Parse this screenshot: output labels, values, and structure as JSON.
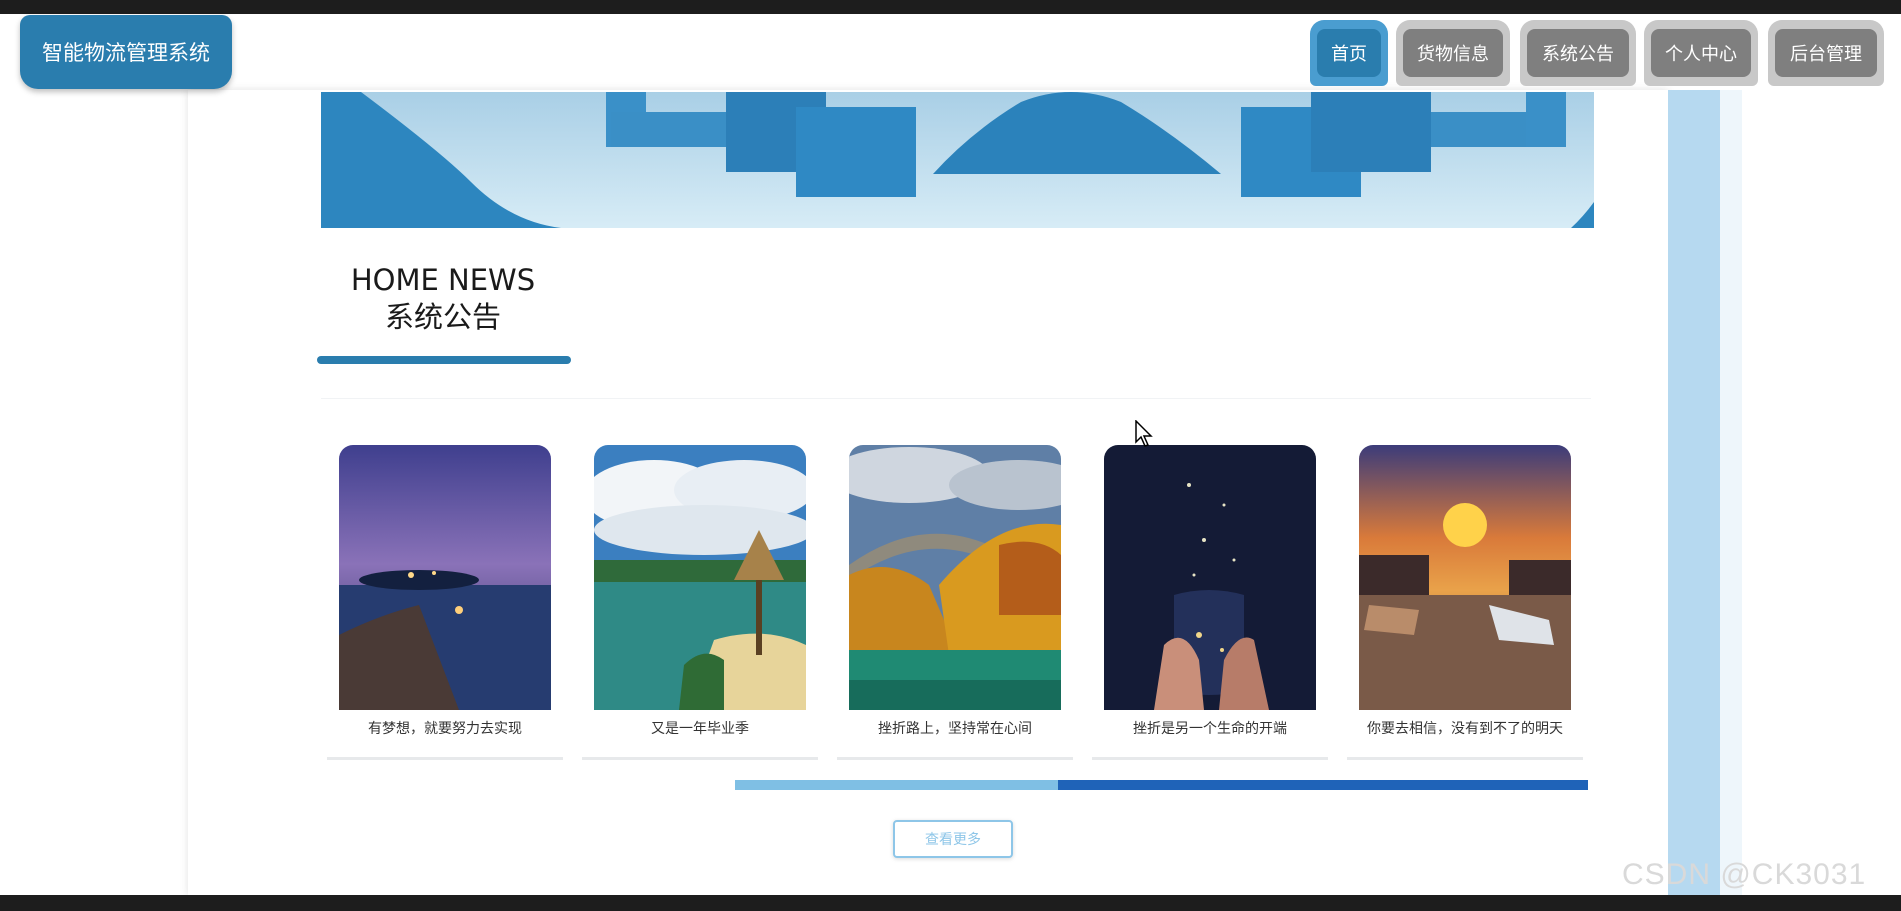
{
  "app": {
    "title": "智能物流管理系统"
  },
  "nav": {
    "items": [
      {
        "label": "首页",
        "active": true
      },
      {
        "label": "货物信息",
        "active": false
      },
      {
        "label": "系统公告",
        "active": false
      },
      {
        "label": "个人中心",
        "active": false
      },
      {
        "label": "后台管理",
        "active": false
      }
    ]
  },
  "section": {
    "title_en": "HOME NEWS",
    "title_zh": "系统公告"
  },
  "news": [
    {
      "caption": "有梦想，就要努力去实现",
      "image": "night-pier-sunset"
    },
    {
      "caption": "又是一年毕业季",
      "image": "tropical-beach-hut"
    },
    {
      "caption": "挫折路上，坚持常在心间",
      "image": "autumn-stone-bridge"
    },
    {
      "caption": "挫折是另一个生命的开端",
      "image": "starry-jar-hands"
    },
    {
      "caption": "你要去相信，没有到不了的明天",
      "image": "sunset-river-city"
    }
  ],
  "carousel": {
    "progress": 0.62
  },
  "more_button": {
    "label": "查看更多"
  },
  "watermark": {
    "text": "CSDN @CK3031"
  },
  "colors": {
    "accent": "#2a7dae",
    "nav_inactive": "#7f7f7f",
    "progress_track": "#7fbfe4",
    "progress_fill": "#1f63b8",
    "rail": "#b6d9f0"
  }
}
